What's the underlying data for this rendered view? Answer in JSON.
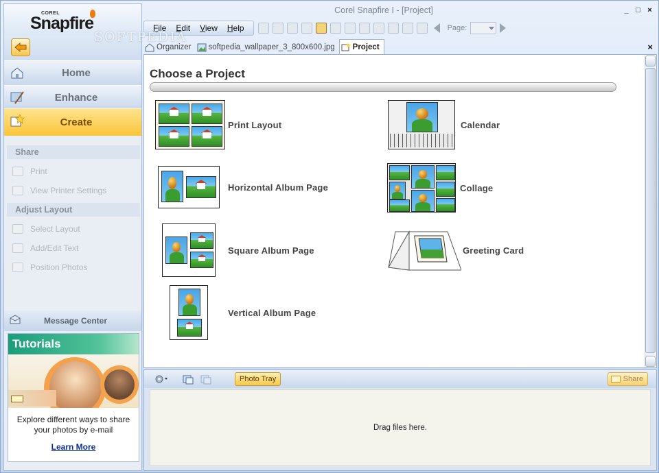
{
  "window": {
    "title": "Corel Snapfire I - [Project]",
    "minimize": "_",
    "maximize": "□",
    "close": "×"
  },
  "logo": {
    "brand": "COREL",
    "product": "Snapfire"
  },
  "watermark": "SOFTPEDIA",
  "menu": [
    {
      "prefix": "",
      "ul": "F",
      "rest": "ile"
    },
    {
      "prefix": "",
      "ul": "E",
      "rest": "dit"
    },
    {
      "prefix": "",
      "ul": "V",
      "rest": "iew"
    },
    {
      "prefix": "",
      "ul": "H",
      "rest": "elp"
    }
  ],
  "toolbar": {
    "page_label": "Page:"
  },
  "tabs": {
    "organizer": "Organizer",
    "file": "softpedia_wallpaper_3_800x600.jpg",
    "project": "Project",
    "close": "×"
  },
  "nav": {
    "home": "Home",
    "enhance": "Enhance",
    "create": "Create"
  },
  "share_section": {
    "header": "Share",
    "items": [
      "Print",
      "View Printer Settings"
    ]
  },
  "layout_section": {
    "header": "Adjust Layout",
    "items": [
      "Select Layout",
      "Add/Edit Text",
      "Position Photos"
    ]
  },
  "message_center": {
    "label": "Message Center"
  },
  "tutorial": {
    "title": "Tutorials",
    "text": "Explore different ways to share your photos by e-mail",
    "link": "Learn More"
  },
  "main": {
    "title": "Choose a Project",
    "projects": {
      "print_layout": "Print Layout",
      "calendar": "Calendar",
      "horizontal_album": "Horizontal Album Page",
      "collage": "Collage",
      "square_album": "Square Album Page",
      "greeting_card": "Greeting Card",
      "vertical_album": "Vertical Album Page"
    }
  },
  "tray": {
    "photo_tray": "Photo Tray",
    "share": "Share",
    "drop_hint": "Drag files here."
  }
}
